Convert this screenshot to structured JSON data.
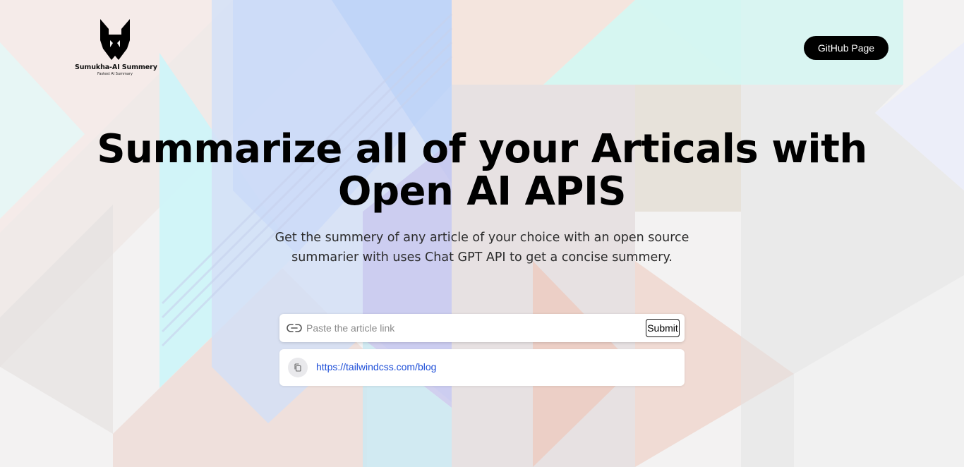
{
  "brand": {
    "name": "Sumukha-AI Summery",
    "tagline": "Fastest AI Summary"
  },
  "header": {
    "github_label": "GitHub Page"
  },
  "hero": {
    "title_line1": "Summarize all of your Articals with",
    "title_line2": "Open AI APIS",
    "subtitle": "Get the summery of any article of your choice with an open source summarier with uses Chat GPT API to get a concise summery."
  },
  "form": {
    "placeholder": "Paste the article link",
    "value": "",
    "submit_label": "Submit"
  },
  "history": [
    {
      "url": "https://tailwindcss.com/blog"
    }
  ],
  "icons": {
    "logo": "helmet-logo-icon",
    "link": "link-icon",
    "copy": "copy-icon"
  }
}
